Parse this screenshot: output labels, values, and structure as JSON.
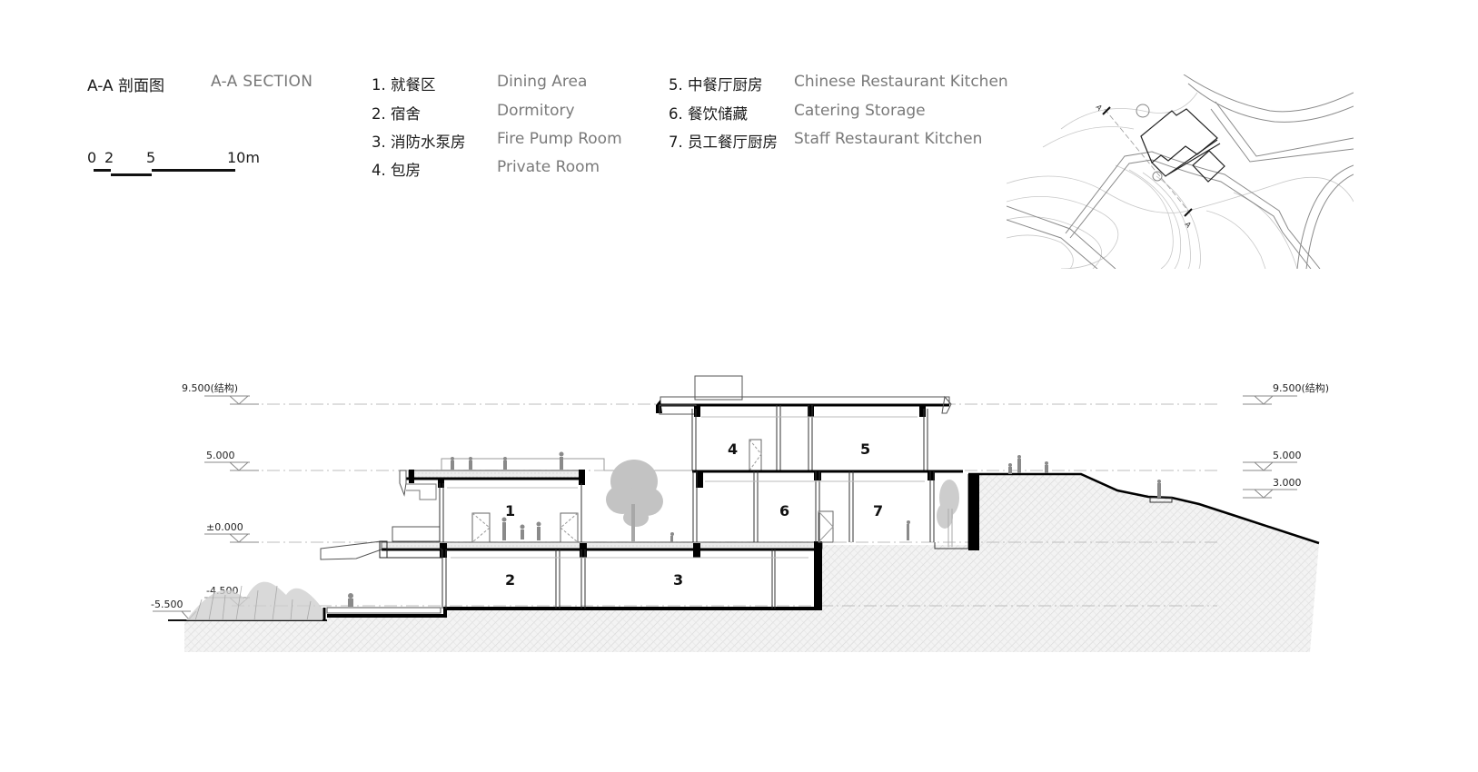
{
  "title": {
    "cn": "A-A  剖面图",
    "en": "A-A  SECTION"
  },
  "scale_bar": {
    "labels": [
      "0",
      "2",
      "5",
      "10m"
    ],
    "unit": "m"
  },
  "legend": [
    {
      "num_cn": "1. 就餐区",
      "en": "Dining Area"
    },
    {
      "num_cn": "2. 宿舍",
      "en": "Dormitory"
    },
    {
      "num_cn": "3. 消防水泵房",
      "en": "Fire Pump Room"
    },
    {
      "num_cn": "4. 包房",
      "en": "Private Room"
    },
    {
      "num_cn": "5. 中餐厅厨房",
      "en": "Chinese Restaurant Kitchen"
    },
    {
      "num_cn": "6. 餐饮储藏",
      "en": "Catering Storage"
    },
    {
      "num_cn": "7. 员工餐厅厨房",
      "en": "Staff Restaurant Kitchen"
    }
  ],
  "levels_left": [
    {
      "label": "9.500(结构)",
      "value": 9.5
    },
    {
      "label": "5.000",
      "value": 5.0
    },
    {
      "label": "±0.000",
      "value": 0.0
    },
    {
      "label": "-4.500",
      "value": -4.5
    },
    {
      "label": "-5.500",
      "value": -5.5
    }
  ],
  "levels_right": [
    {
      "label": "9.500(结构)",
      "value": 9.5
    },
    {
      "label": "5.000",
      "value": 5.0
    },
    {
      "label": "3.000",
      "value": 3.0
    }
  ],
  "room_tags": [
    "1",
    "2",
    "3",
    "4",
    "5",
    "6",
    "7"
  ],
  "key_plan": {
    "section_marker": "A"
  },
  "colors": {
    "ink": "#000000",
    "line": "#555555",
    "grey_text": "#7a7a7a",
    "hatch": "#d8d8d8",
    "vegetation": "#b5b5b5"
  }
}
